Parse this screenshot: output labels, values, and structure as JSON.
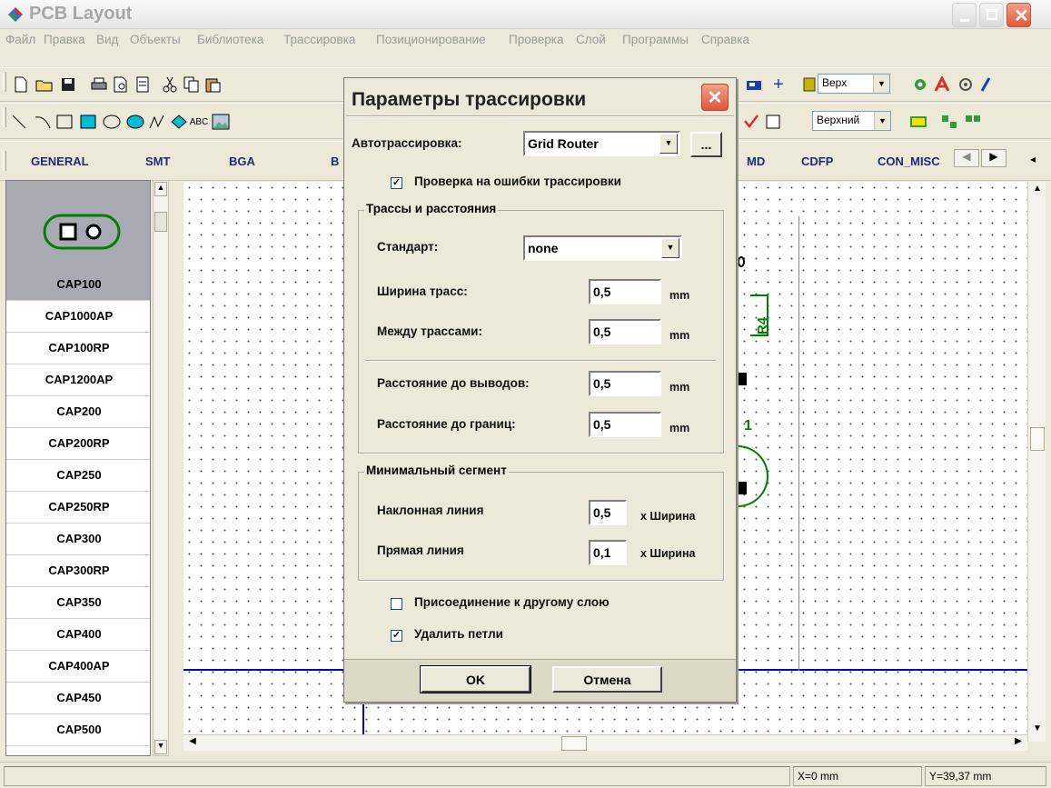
{
  "window": {
    "title": "PCB Layout"
  },
  "menu": [
    "Файл",
    "Правка",
    "Вид",
    "Объекты",
    "Библиотека",
    "Трассировка",
    "Позиционирование",
    "Проверка",
    "Слой",
    "Программы",
    "Справка"
  ],
  "toolbar": {
    "layer_combo": "Верх",
    "layer_combo2": "Верхний",
    "text_tool_label": "ABC"
  },
  "library_tabs": [
    "GENERAL",
    "SMT",
    "BGA",
    "B",
    "MD",
    "CDFP",
    "CON_MISC"
  ],
  "components": [
    "CAP100",
    "CAP1000AP",
    "CAP100RP",
    "CAP1200AP",
    "CAP200",
    "CAP200RP",
    "CAP250",
    "CAP250RP",
    "CAP300",
    "CAP300RP",
    "CAP350",
    "CAP400",
    "CAP400AP",
    "CAP450",
    "CAP500"
  ],
  "canvas": {
    "ref_label": "R4",
    "ref_label2": "1"
  },
  "status": {
    "x": "X=0 mm",
    "y": "Y=39,37 mm"
  },
  "dialog": {
    "title": "Параметры трассировки",
    "autorouter_label": "Автотрассировка:",
    "autorouter_value": "Grid Router",
    "more_button": "...",
    "check_errors": {
      "label": "Проверка на ошибки трассировки",
      "checked": true
    },
    "group_tracks": "Трассы и расстояния",
    "standard_label": "Стандарт:",
    "standard_value": "none",
    "track_width_label": "Ширина трасс:",
    "track_width_value": "0,5",
    "between_tracks_label": "Между трассами:",
    "between_tracks_value": "0,5",
    "to_pads_label": "Расстояние до выводов:",
    "to_pads_value": "0,5",
    "to_edges_label": "Расстояние до границ:",
    "to_edges_value": "0,5",
    "unit": "mm",
    "group_segment": "Минимальный сегмент",
    "diagonal_label": "Наклонная линия",
    "diagonal_value": "0,5",
    "straight_label": "Прямая линия",
    "straight_value": "0,1",
    "width_suffix": "x Ширина",
    "connect_layer": {
      "label": "Присоединение к другому слою",
      "checked": false
    },
    "remove_loops": {
      "label": "Удалить петли",
      "checked": true
    },
    "ok_button": "OK",
    "cancel_button": "Отмена"
  },
  "colors": {
    "accent_green": "#008000",
    "selection": "#a9a9b4",
    "board_outline": "#0000cc"
  }
}
